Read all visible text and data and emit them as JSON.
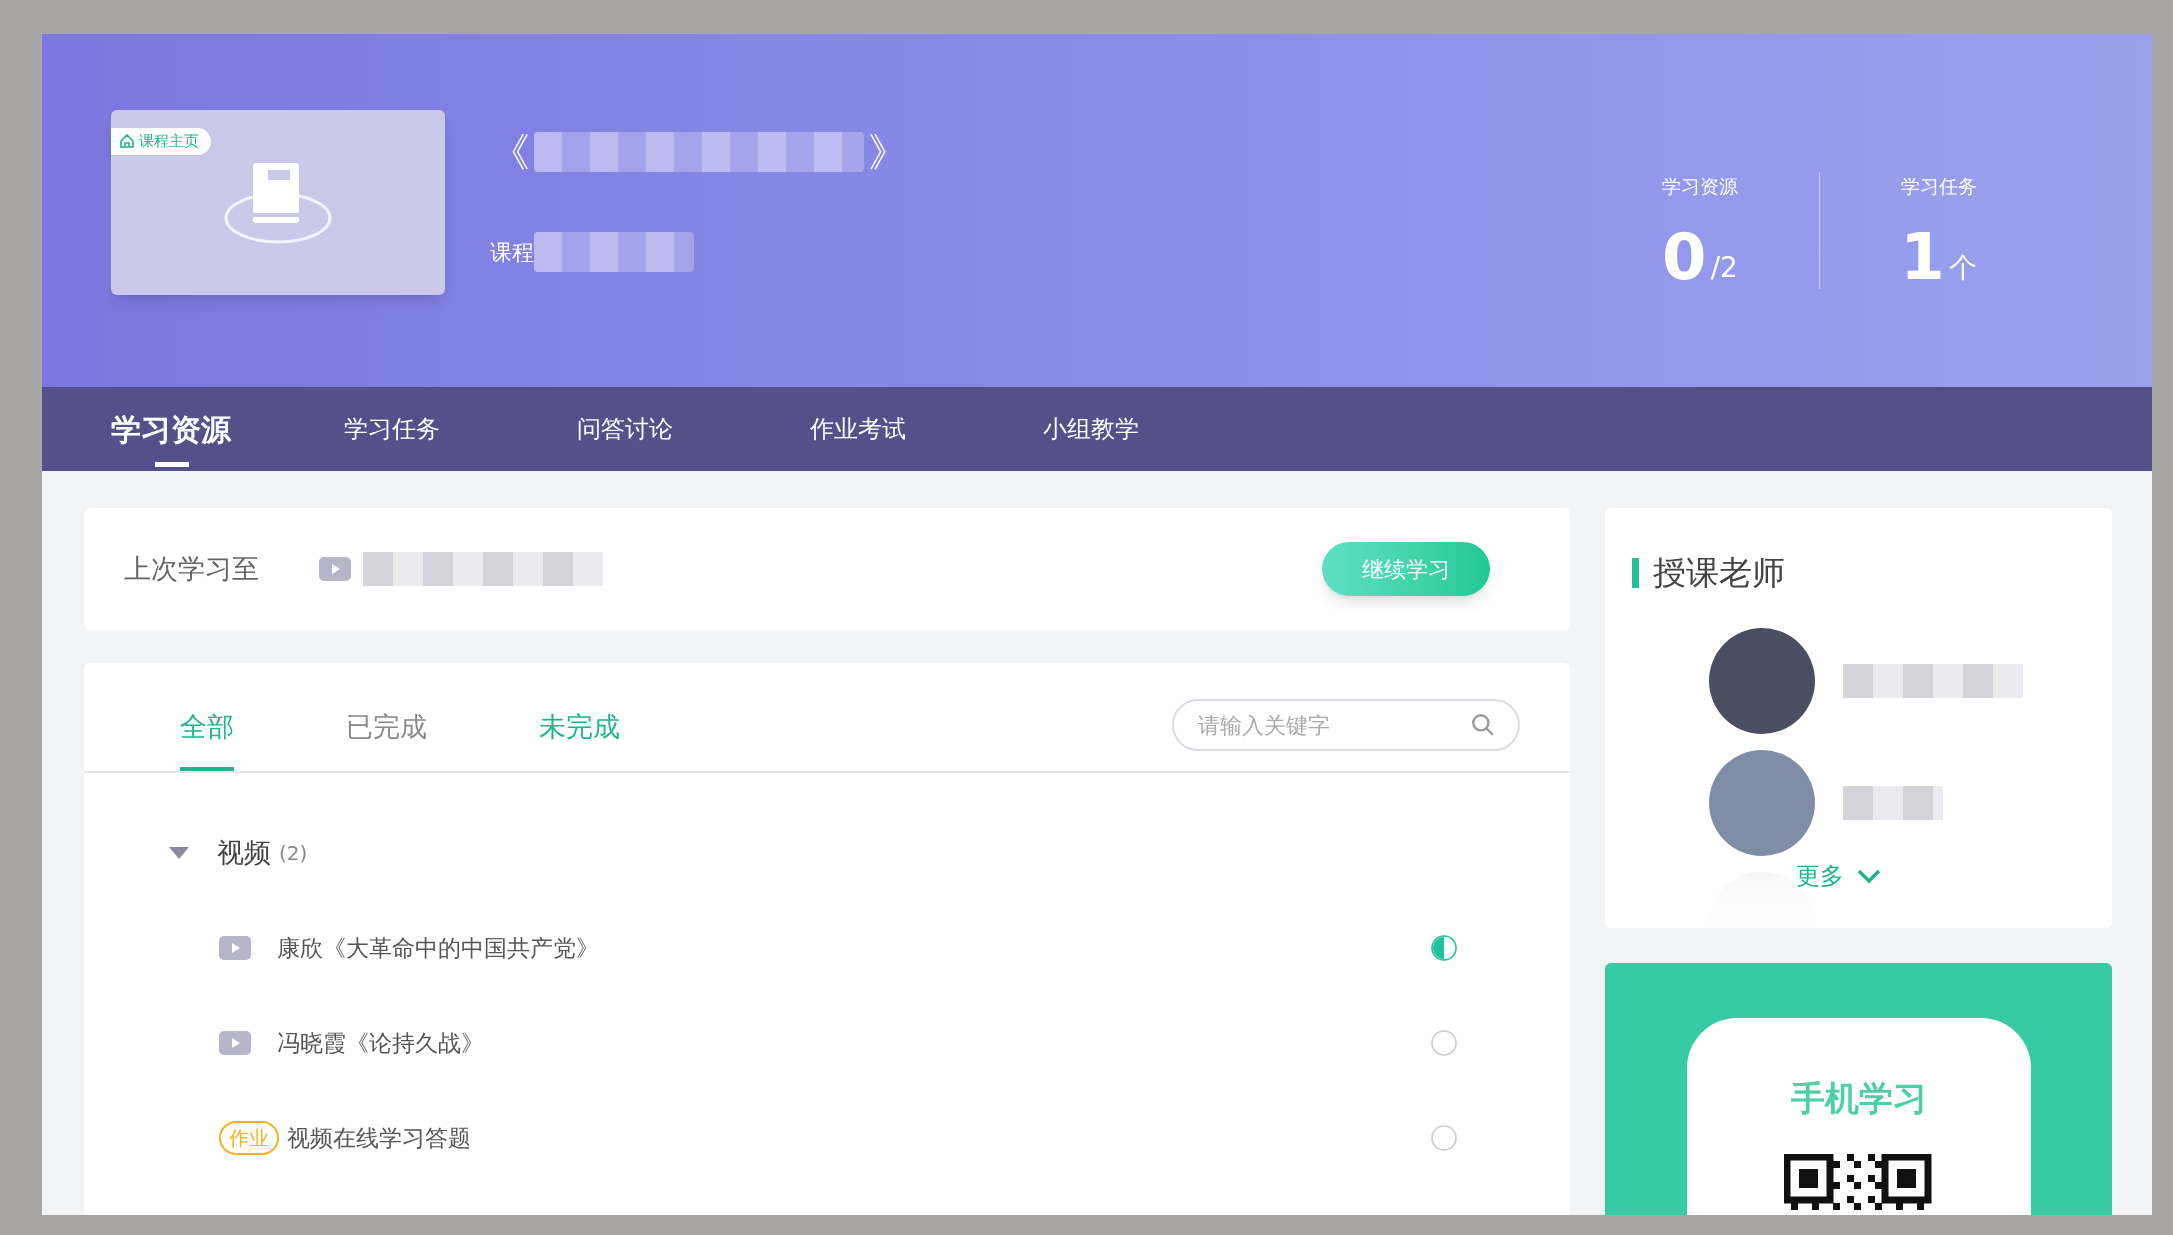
{
  "course": {
    "badge": "课程主页",
    "title_open": "《",
    "title_close": "》",
    "code_label": "课程"
  },
  "stats": [
    {
      "label": "学习资源",
      "value": "0",
      "unit": "/2"
    },
    {
      "label": "学习任务",
      "value": "1",
      "unit": "个"
    }
  ],
  "nav_tabs": [
    {
      "label": "学习资源",
      "selected": true
    },
    {
      "label": "学习任务",
      "selected": false
    },
    {
      "label": "问答讨论",
      "selected": false
    },
    {
      "label": "作业考试",
      "selected": false
    },
    {
      "label": "小组教学",
      "selected": false
    }
  ],
  "last_study": {
    "label": "上次学习至",
    "button": "继续学习"
  },
  "filter_tabs": [
    {
      "label": "全部",
      "selected": true,
      "accent": true
    },
    {
      "label": "已完成",
      "selected": false,
      "accent": false
    },
    {
      "label": "未完成",
      "selected": false,
      "accent": true
    }
  ],
  "search": {
    "placeholder": "请输入关键字"
  },
  "group": {
    "title": "视频",
    "count": "(2)",
    "expanded": true
  },
  "items": [
    {
      "kind": "video",
      "title": "康欣《大革命中的中国共产党》",
      "in_progress": true
    },
    {
      "kind": "video",
      "title": "冯晓霞《论持久战》",
      "in_progress": false
    },
    {
      "kind": "assignment",
      "tag": "作业",
      "title": "视频在线学习答题",
      "in_progress": false
    }
  ],
  "teachers": {
    "title": "授课老师",
    "more": "更多"
  },
  "mobile": {
    "title": "手机学习"
  }
}
